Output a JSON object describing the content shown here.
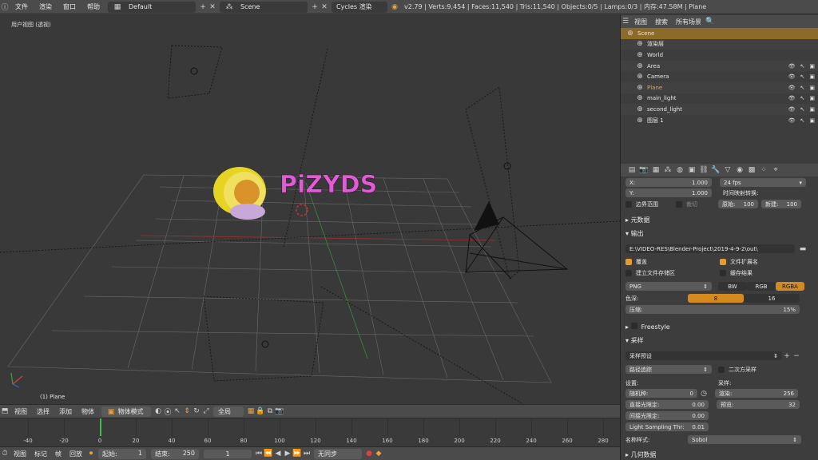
{
  "topbar": {
    "menus": [
      "文件",
      "渲染",
      "窗口",
      "帮助"
    ],
    "layout": "Default",
    "scene": "Scene",
    "engine": "Cycles 渲染",
    "stats": "v2.79 | Verts:9,454 | Faces:11,540 | Tris:11,540 | Objects:0/5 | Lamps:0/3 | 内存:47.58M | Plane"
  },
  "viewport": {
    "title": "用户视图 (透视)",
    "object_label": "(1) Plane",
    "logo_text": "PiZYDS"
  },
  "vpbar": {
    "menus": [
      "视图",
      "选择",
      "添加",
      "物体"
    ],
    "mode": "物体模式",
    "pivot": "全局"
  },
  "timeline": {
    "ticks": [
      "-40",
      "-20",
      "0",
      "20",
      "40",
      "60",
      "80",
      "100",
      "120",
      "140",
      "160",
      "180",
      "200",
      "220",
      "240",
      "260",
      "280"
    ],
    "current_frame": 0
  },
  "tlbar": {
    "menus": [
      "视图",
      "标记",
      "帧",
      "回放"
    ],
    "start_label": "起始:",
    "start_value": "1",
    "end_label": "结束:",
    "end_value": "250",
    "current": "1",
    "sync": "无同步"
  },
  "outliner": {
    "menus": [
      "视图",
      "搜索",
      "所有场景"
    ],
    "rows": [
      {
        "name": "Scene",
        "indent": 0,
        "selected": true
      },
      {
        "name": "渲染层",
        "indent": 1
      },
      {
        "name": "World",
        "indent": 1
      },
      {
        "name": "Area",
        "indent": 1
      },
      {
        "name": "Camera",
        "indent": 1
      },
      {
        "name": "Plane",
        "indent": 1,
        "highlight": true
      },
      {
        "name": "main_light",
        "indent": 1
      },
      {
        "name": "second_light",
        "indent": 1
      },
      {
        "name": "图层 1",
        "indent": 1
      }
    ]
  },
  "props": {
    "x_label": "X:",
    "x_value": "1.000",
    "y_label": "Y:",
    "y_value": "1.000",
    "fps": "24 fps",
    "remap_label": "时间映射转换:",
    "border": "边界范围",
    "crop": "裁切",
    "old_label": "原始:",
    "old_value": "100",
    "new_label": "新建:",
    "new_value": "100",
    "metadata": "元数据",
    "output": "输出",
    "path": "E:\\VIDEO-RES\\Blender-Project\\2019-4-9-2\\out\\",
    "overwrite": "覆盖",
    "extensions": "文件扩展名",
    "placeholders": "建立文件存储区",
    "cache": "缓存结果",
    "format": "PNG",
    "bw": "BW",
    "rgb": "RGB",
    "rgba": "RGBA",
    "depth_label": "色深:",
    "depth_8": "8",
    "depth_16": "16",
    "compress_label": "压缩:",
    "compress_value": "15%",
    "freestyle": "Freestyle",
    "sampling": "采样",
    "presets": "采样预设",
    "integrator": "路径追踪",
    "square": "二次方采样",
    "settings_label": "设置:",
    "samples_label": "采样:",
    "seed_label": "随机种:",
    "seed_value": "0",
    "clamp_direct_label": "直接光限定:",
    "clamp_direct_value": "0.00",
    "clamp_indirect_label": "间接光限定:",
    "clamp_indirect_value": "0.00",
    "light_threshold_label": "Light Sampling Thr:",
    "light_threshold_value": "0.01",
    "render_label": "渲染:",
    "render_value": "256",
    "preview_label": "预览:",
    "preview_value": "32",
    "pattern_label": "名称样式:",
    "pattern_value": "Sobol",
    "geometry": "几何数据"
  }
}
